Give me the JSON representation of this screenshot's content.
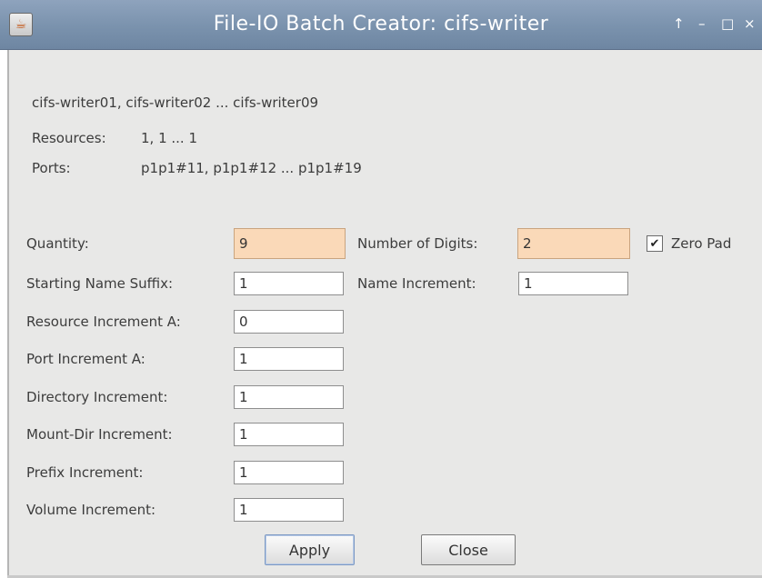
{
  "window": {
    "title": "File-IO Batch Creator: cifs-writer",
    "controls": [
      "↑",
      "–",
      "□",
      "×"
    ]
  },
  "summary": {
    "names": "cifs-writer01, cifs-writer02 ... cifs-writer09",
    "resources_label": "Resources:",
    "resources_value": "1, 1 ... 1",
    "ports_label": "Ports:",
    "ports_value": "p1p1#11, p1p1#12 ... p1p1#19"
  },
  "form": {
    "quantity": {
      "label": "Quantity:",
      "value": "9"
    },
    "num_digits": {
      "label": "Number of Digits:",
      "value": "2"
    },
    "zero_pad": {
      "label": "Zero Pad",
      "checked": true
    },
    "start_suffix": {
      "label": "Starting Name Suffix:",
      "value": "1"
    },
    "name_increment": {
      "label": "Name Increment:",
      "value": "1"
    },
    "resource_increment": {
      "label": "Resource Increment A:",
      "value": "0"
    },
    "port_increment": {
      "label": "Port Increment A:",
      "value": "1"
    },
    "directory_increment": {
      "label": "Directory Increment:",
      "value": "1"
    },
    "mount_increment": {
      "label": "Mount-Dir Increment:",
      "value": "1"
    },
    "prefix_increment": {
      "label": "Prefix Increment:",
      "value": "1"
    },
    "volume_increment": {
      "label": "Volume Increment:",
      "value": "1"
    }
  },
  "buttons": {
    "apply": "Apply",
    "close": "Close"
  },
  "colors": {
    "titlebar": "#7a92ad",
    "highlight_field": "#fad9b8",
    "panel": "#e8e8e7"
  }
}
